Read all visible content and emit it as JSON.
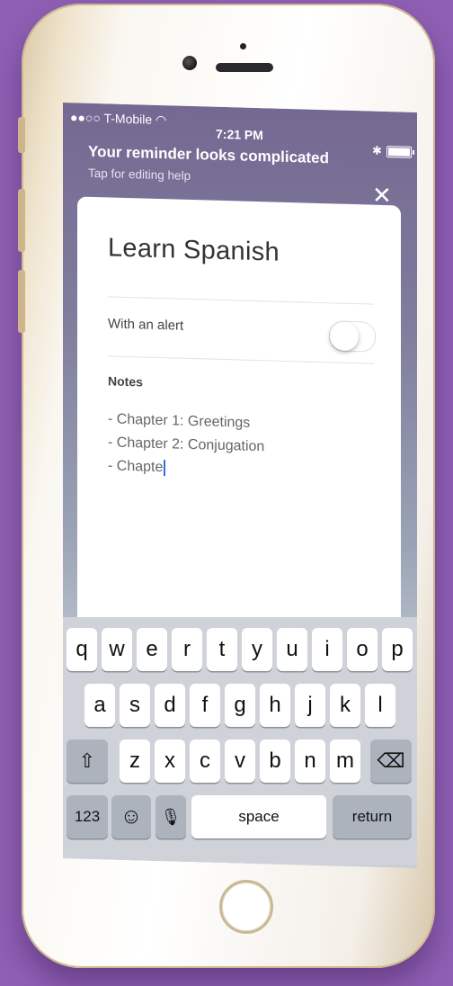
{
  "statusbar": {
    "carrier": "●●○○ T-Mobile ◠",
    "time": "7:21 PM",
    "bluetooth": "✱"
  },
  "banner": {
    "title": "Your reminder looks complicated",
    "subtitle": "Tap for editing help",
    "close": "✕"
  },
  "reminder": {
    "title": "Learn Spanish",
    "alert_label": "With an alert",
    "alert_enabled": false,
    "notes_label": "Notes",
    "notes": [
      "- Chapter 1: Greetings",
      "- Chapter 2: Conjugation",
      "- Chapte"
    ]
  },
  "keyboard": {
    "row1": [
      "q",
      "w",
      "e",
      "r",
      "t",
      "y",
      "u",
      "i",
      "o",
      "p"
    ],
    "row2": [
      "a",
      "s",
      "d",
      "f",
      "g",
      "h",
      "j",
      "k",
      "l"
    ],
    "row3": [
      "z",
      "x",
      "c",
      "v",
      "b",
      "n",
      "m"
    ],
    "shift": "⇧",
    "delete": "⌫",
    "numbers": "123",
    "emoji": "☺",
    "mic": "🎙",
    "space": "space",
    "return": "return"
  },
  "colors": {
    "background": "#8e5fb4",
    "banner_gradient_top": "#756892",
    "caret": "#2f6fe0"
  }
}
